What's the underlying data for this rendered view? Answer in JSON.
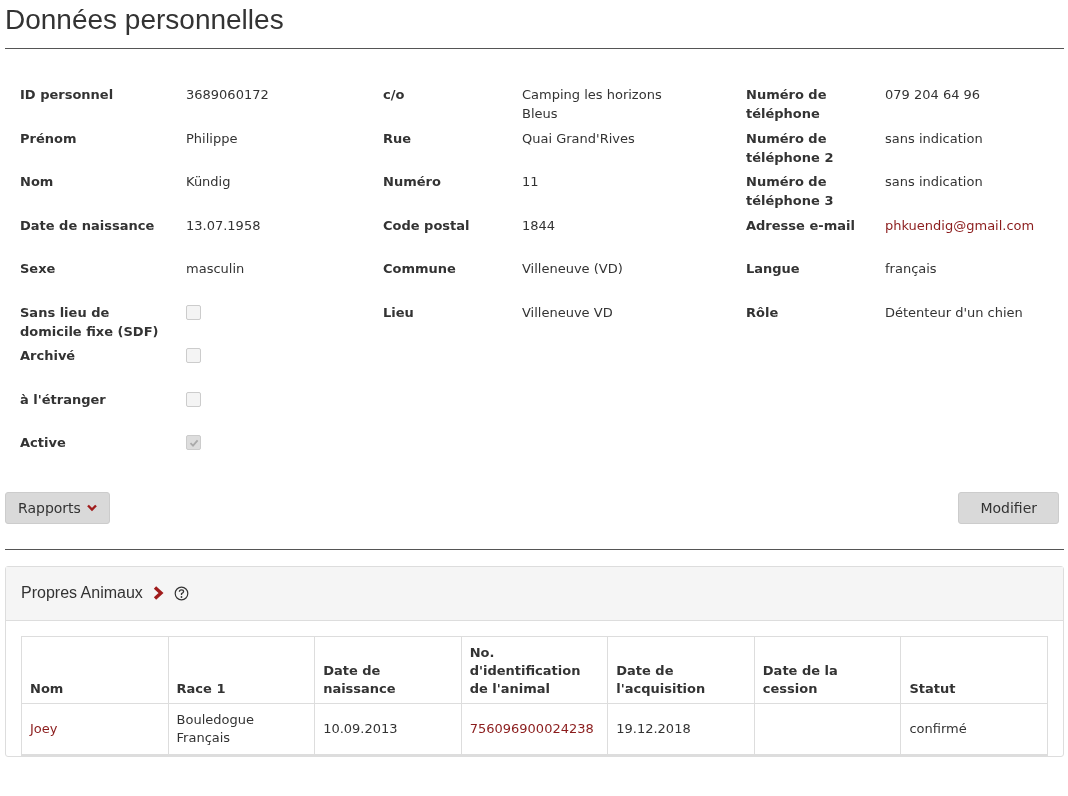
{
  "title": "Données personnelles",
  "columns": [
    [
      {
        "label": "ID personnel",
        "kind": "text",
        "value": "3689060172"
      },
      {
        "label": "Prénom",
        "kind": "text",
        "value": "Philippe"
      },
      {
        "label": "Nom",
        "kind": "text",
        "value": "Kündig"
      },
      {
        "label": "Date de naissance",
        "kind": "text",
        "value": "13.07.1958"
      },
      {
        "label": "Sexe",
        "kind": "text",
        "value": "masculin"
      },
      {
        "label": "Sans lieu de domicile fixe (SDF)",
        "kind": "checkbox",
        "checked": false
      },
      {
        "label": "Archivé",
        "kind": "checkbox",
        "checked": false
      },
      {
        "label": "à l'étranger",
        "kind": "checkbox",
        "checked": false
      },
      {
        "label": "Active",
        "kind": "checkbox",
        "checked": true
      }
    ],
    [
      {
        "label": "c/o",
        "kind": "text",
        "value": "Camping les horizons Bleus"
      },
      {
        "label": "Rue",
        "kind": "text",
        "value": "Quai Grand'Rives"
      },
      {
        "label": "Numéro",
        "kind": "text",
        "value": "11"
      },
      {
        "label": "Code postal",
        "kind": "text",
        "value": "1844"
      },
      {
        "label": "Commune",
        "kind": "text",
        "value": "Villeneuve (VD)"
      },
      {
        "label": "Lieu",
        "kind": "text",
        "value": "Villeneuve VD"
      }
    ],
    [
      {
        "label": "Numéro de téléphone",
        "kind": "text",
        "value": "079 204 64 96"
      },
      {
        "label": "Numéro de téléphone 2",
        "kind": "text",
        "value": "sans indication"
      },
      {
        "label": "Numéro de téléphone 3",
        "kind": "text",
        "value": "sans indication"
      },
      {
        "label": "Adresse e-mail",
        "kind": "link",
        "value": "phkuendig@gmail.com"
      },
      {
        "label": "Langue",
        "kind": "text",
        "value": "français"
      },
      {
        "label": "Rôle",
        "kind": "text",
        "value": "Détenteur d'un chien"
      }
    ]
  ],
  "buttons": {
    "reports": "Rapports",
    "edit": "Modifier"
  },
  "animals": {
    "title": "Propres Animaux",
    "columns": [
      "Nom",
      "Race 1",
      "Date de naissance",
      "No. d'identification de l'animal",
      "Date de l'acquisition",
      "Date de la cession",
      "Statut"
    ],
    "rows": [
      [
        {
          "kind": "link",
          "text": "Joey"
        },
        {
          "kind": "text",
          "text": "Bouledogue Français"
        },
        {
          "kind": "text",
          "text": "10.09.2013"
        },
        {
          "kind": "link",
          "text": "756096900024238"
        },
        {
          "kind": "text",
          "text": "19.12.2018"
        },
        {
          "kind": "empty"
        },
        {
          "kind": "text",
          "text": "confirmé"
        }
      ]
    ]
  }
}
